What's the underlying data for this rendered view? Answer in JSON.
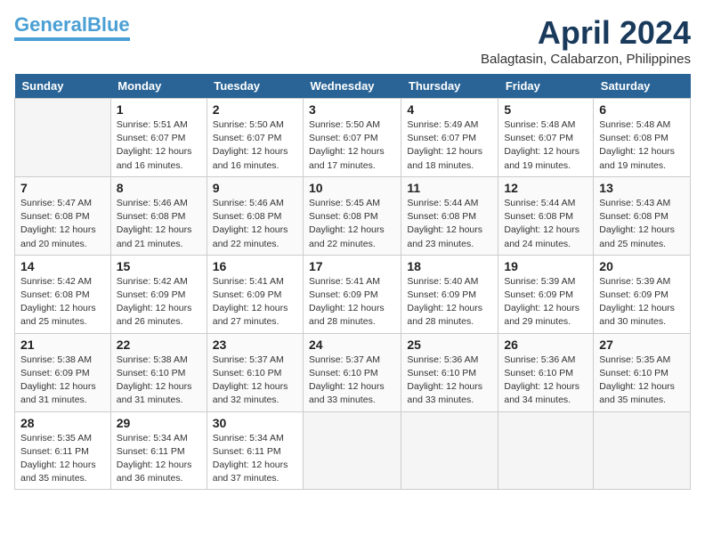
{
  "header": {
    "logo_line1": "General",
    "logo_line2": "Blue",
    "month_title": "April 2024",
    "location": "Balagtasin, Calabarzon, Philippines"
  },
  "weekdays": [
    "Sunday",
    "Monday",
    "Tuesday",
    "Wednesday",
    "Thursday",
    "Friday",
    "Saturday"
  ],
  "weeks": [
    [
      {
        "day": "",
        "info": ""
      },
      {
        "day": "1",
        "info": "Sunrise: 5:51 AM\nSunset: 6:07 PM\nDaylight: 12 hours\nand 16 minutes."
      },
      {
        "day": "2",
        "info": "Sunrise: 5:50 AM\nSunset: 6:07 PM\nDaylight: 12 hours\nand 16 minutes."
      },
      {
        "day": "3",
        "info": "Sunrise: 5:50 AM\nSunset: 6:07 PM\nDaylight: 12 hours\nand 17 minutes."
      },
      {
        "day": "4",
        "info": "Sunrise: 5:49 AM\nSunset: 6:07 PM\nDaylight: 12 hours\nand 18 minutes."
      },
      {
        "day": "5",
        "info": "Sunrise: 5:48 AM\nSunset: 6:07 PM\nDaylight: 12 hours\nand 19 minutes."
      },
      {
        "day": "6",
        "info": "Sunrise: 5:48 AM\nSunset: 6:08 PM\nDaylight: 12 hours\nand 19 minutes."
      }
    ],
    [
      {
        "day": "7",
        "info": "Sunrise: 5:47 AM\nSunset: 6:08 PM\nDaylight: 12 hours\nand 20 minutes."
      },
      {
        "day": "8",
        "info": "Sunrise: 5:46 AM\nSunset: 6:08 PM\nDaylight: 12 hours\nand 21 minutes."
      },
      {
        "day": "9",
        "info": "Sunrise: 5:46 AM\nSunset: 6:08 PM\nDaylight: 12 hours\nand 22 minutes."
      },
      {
        "day": "10",
        "info": "Sunrise: 5:45 AM\nSunset: 6:08 PM\nDaylight: 12 hours\nand 22 minutes."
      },
      {
        "day": "11",
        "info": "Sunrise: 5:44 AM\nSunset: 6:08 PM\nDaylight: 12 hours\nand 23 minutes."
      },
      {
        "day": "12",
        "info": "Sunrise: 5:44 AM\nSunset: 6:08 PM\nDaylight: 12 hours\nand 24 minutes."
      },
      {
        "day": "13",
        "info": "Sunrise: 5:43 AM\nSunset: 6:08 PM\nDaylight: 12 hours\nand 25 minutes."
      }
    ],
    [
      {
        "day": "14",
        "info": "Sunrise: 5:42 AM\nSunset: 6:08 PM\nDaylight: 12 hours\nand 25 minutes."
      },
      {
        "day": "15",
        "info": "Sunrise: 5:42 AM\nSunset: 6:09 PM\nDaylight: 12 hours\nand 26 minutes."
      },
      {
        "day": "16",
        "info": "Sunrise: 5:41 AM\nSunset: 6:09 PM\nDaylight: 12 hours\nand 27 minutes."
      },
      {
        "day": "17",
        "info": "Sunrise: 5:41 AM\nSunset: 6:09 PM\nDaylight: 12 hours\nand 28 minutes."
      },
      {
        "day": "18",
        "info": "Sunrise: 5:40 AM\nSunset: 6:09 PM\nDaylight: 12 hours\nand 28 minutes."
      },
      {
        "day": "19",
        "info": "Sunrise: 5:39 AM\nSunset: 6:09 PM\nDaylight: 12 hours\nand 29 minutes."
      },
      {
        "day": "20",
        "info": "Sunrise: 5:39 AM\nSunset: 6:09 PM\nDaylight: 12 hours\nand 30 minutes."
      }
    ],
    [
      {
        "day": "21",
        "info": "Sunrise: 5:38 AM\nSunset: 6:09 PM\nDaylight: 12 hours\nand 31 minutes."
      },
      {
        "day": "22",
        "info": "Sunrise: 5:38 AM\nSunset: 6:10 PM\nDaylight: 12 hours\nand 31 minutes."
      },
      {
        "day": "23",
        "info": "Sunrise: 5:37 AM\nSunset: 6:10 PM\nDaylight: 12 hours\nand 32 minutes."
      },
      {
        "day": "24",
        "info": "Sunrise: 5:37 AM\nSunset: 6:10 PM\nDaylight: 12 hours\nand 33 minutes."
      },
      {
        "day": "25",
        "info": "Sunrise: 5:36 AM\nSunset: 6:10 PM\nDaylight: 12 hours\nand 33 minutes."
      },
      {
        "day": "26",
        "info": "Sunrise: 5:36 AM\nSunset: 6:10 PM\nDaylight: 12 hours\nand 34 minutes."
      },
      {
        "day": "27",
        "info": "Sunrise: 5:35 AM\nSunset: 6:10 PM\nDaylight: 12 hours\nand 35 minutes."
      }
    ],
    [
      {
        "day": "28",
        "info": "Sunrise: 5:35 AM\nSunset: 6:11 PM\nDaylight: 12 hours\nand 35 minutes."
      },
      {
        "day": "29",
        "info": "Sunrise: 5:34 AM\nSunset: 6:11 PM\nDaylight: 12 hours\nand 36 minutes."
      },
      {
        "day": "30",
        "info": "Sunrise: 5:34 AM\nSunset: 6:11 PM\nDaylight: 12 hours\nand 37 minutes."
      },
      {
        "day": "",
        "info": ""
      },
      {
        "day": "",
        "info": ""
      },
      {
        "day": "",
        "info": ""
      },
      {
        "day": "",
        "info": ""
      }
    ]
  ]
}
